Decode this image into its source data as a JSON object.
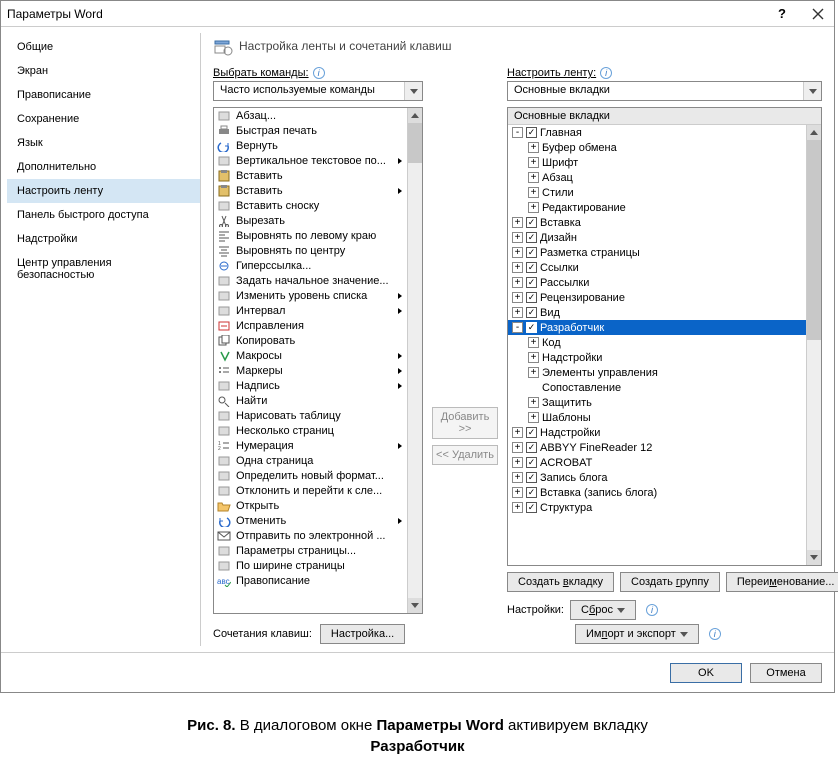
{
  "title": "Параметры Word",
  "sidebar": {
    "items": [
      {
        "label": "Общие"
      },
      {
        "label": "Экран"
      },
      {
        "label": "Правописание"
      },
      {
        "label": "Сохранение"
      },
      {
        "label": "Язык"
      },
      {
        "label": "Дополнительно"
      },
      {
        "label": "Настроить ленту"
      },
      {
        "label": "Панель быстрого доступа"
      },
      {
        "label": "Надстройки"
      },
      {
        "label": "Центр управления безопасностью"
      }
    ],
    "active_index": 6
  },
  "header": {
    "text": "Настройка ленты и сочетаний клавиш"
  },
  "left_col": {
    "label": "Выбрать команды:",
    "combo_value": "Часто используемые команды",
    "kbd_label": "Сочетания клавиш:",
    "kbd_button": "Настройка...",
    "commands": [
      {
        "label": "Абзац...",
        "icon": "paragraph"
      },
      {
        "label": "Быстрая печать",
        "icon": "print"
      },
      {
        "label": "Вернуть",
        "icon": "redo"
      },
      {
        "label": "Вертикальное текстовое по...",
        "icon": "text-vert",
        "exp": true
      },
      {
        "label": "Вставить",
        "icon": "paste"
      },
      {
        "label": "Вставить",
        "icon": "paste-alt",
        "exp": true
      },
      {
        "label": "Вставить сноску",
        "icon": "footnote"
      },
      {
        "label": "Вырезать",
        "icon": "cut"
      },
      {
        "label": "Выровнять по левому краю",
        "icon": "align-left"
      },
      {
        "label": "Выровнять по центру",
        "icon": "align-center"
      },
      {
        "label": "Гиперссылка...",
        "icon": "link"
      },
      {
        "label": "Задать начальное значение...",
        "icon": "number-start"
      },
      {
        "label": "Изменить уровень списка",
        "icon": "list-level",
        "exp": true
      },
      {
        "label": "Интервал",
        "icon": "spacing",
        "exp": true
      },
      {
        "label": "Исправления",
        "icon": "track"
      },
      {
        "label": "Копировать",
        "icon": "copy"
      },
      {
        "label": "Макросы",
        "icon": "macro",
        "exp": true
      },
      {
        "label": "Маркеры",
        "icon": "bullets",
        "exp": true
      },
      {
        "label": "Надпись",
        "icon": "textbox",
        "exp": true
      },
      {
        "label": "Найти",
        "icon": "find"
      },
      {
        "label": "Нарисовать таблицу",
        "icon": "draw-table"
      },
      {
        "label": "Несколько страниц",
        "icon": "multi-page"
      },
      {
        "label": "Нумерация",
        "icon": "numbering",
        "exp": true
      },
      {
        "label": "Одна страница",
        "icon": "one-page"
      },
      {
        "label": "Определить новый формат...",
        "icon": "new-format"
      },
      {
        "label": "Отклонить и перейти к сле...",
        "icon": "reject"
      },
      {
        "label": "Открыть",
        "icon": "open"
      },
      {
        "label": "Отменить",
        "icon": "undo",
        "exp": true
      },
      {
        "label": "Отправить по электронной ...",
        "icon": "email"
      },
      {
        "label": "Параметры страницы...",
        "icon": "page-setup"
      },
      {
        "label": "По ширине страницы",
        "icon": "page-width"
      },
      {
        "label": "Правописание",
        "icon": "spelling"
      }
    ]
  },
  "mid": {
    "add_btn": "Добавить >>",
    "remove_btn": "<< Удалить"
  },
  "right_col": {
    "label": "Настроить ленту:",
    "combo_value": "Основные вкладки",
    "tree_header": "Основные вкладки",
    "tree": [
      {
        "indent": 0,
        "pm": "-",
        "cb": true,
        "label": "Главная"
      },
      {
        "indent": 1,
        "pm": "+",
        "cb": null,
        "label": "Буфер обмена"
      },
      {
        "indent": 1,
        "pm": "+",
        "cb": null,
        "label": "Шрифт"
      },
      {
        "indent": 1,
        "pm": "+",
        "cb": null,
        "label": "Абзац"
      },
      {
        "indent": 1,
        "pm": "+",
        "cb": null,
        "label": "Стили"
      },
      {
        "indent": 1,
        "pm": "+",
        "cb": null,
        "label": "Редактирование"
      },
      {
        "indent": 0,
        "pm": "+",
        "cb": true,
        "label": "Вставка"
      },
      {
        "indent": 0,
        "pm": "+",
        "cb": true,
        "label": "Дизайн"
      },
      {
        "indent": 0,
        "pm": "+",
        "cb": true,
        "label": "Разметка страницы"
      },
      {
        "indent": 0,
        "pm": "+",
        "cb": true,
        "label": "Ссылки"
      },
      {
        "indent": 0,
        "pm": "+",
        "cb": true,
        "label": "Рассылки"
      },
      {
        "indent": 0,
        "pm": "+",
        "cb": true,
        "label": "Рецензирование"
      },
      {
        "indent": 0,
        "pm": "+",
        "cb": true,
        "label": "Вид"
      },
      {
        "indent": 0,
        "pm": "-",
        "cb": true,
        "label": "Разработчик",
        "sel": true
      },
      {
        "indent": 1,
        "pm": "+",
        "cb": null,
        "label": "Код"
      },
      {
        "indent": 1,
        "pm": "+",
        "cb": null,
        "label": "Надстройки"
      },
      {
        "indent": 1,
        "pm": "+",
        "cb": null,
        "label": "Элементы управления"
      },
      {
        "indent": 1,
        "pm": " ",
        "cb": null,
        "label": "Сопоставление"
      },
      {
        "indent": 1,
        "pm": "+",
        "cb": null,
        "label": "Защитить"
      },
      {
        "indent": 1,
        "pm": "+",
        "cb": null,
        "label": "Шаблоны"
      },
      {
        "indent": 0,
        "pm": "+",
        "cb": true,
        "label": "Надстройки"
      },
      {
        "indent": 0,
        "pm": "+",
        "cb": true,
        "label": "ABBYY FineReader 12"
      },
      {
        "indent": 0,
        "pm": "+",
        "cb": true,
        "label": "ACROBAT"
      },
      {
        "indent": 0,
        "pm": "+",
        "cb": true,
        "label": "Запись блога"
      },
      {
        "indent": 0,
        "pm": "+",
        "cb": true,
        "label": "Вставка (запись блога)"
      },
      {
        "indent": 0,
        "pm": "+",
        "cb": true,
        "label": "Структура"
      }
    ],
    "btn_new_tab": "Создать вкладку",
    "btn_new_group": "Создать группу",
    "btn_rename": "Переименование...",
    "settings_label": "Настройки:",
    "btn_reset": "Сброс",
    "btn_import": "Импорт и экспорт"
  },
  "footer": {
    "ok": "OK",
    "cancel": "Отмена"
  },
  "caption": {
    "prefix": "Рис. 8. ",
    "t1": "В диалоговом окне ",
    "b1": "Параметры Word",
    "t2": " активируем вкладку ",
    "b2": "Разработчик"
  }
}
